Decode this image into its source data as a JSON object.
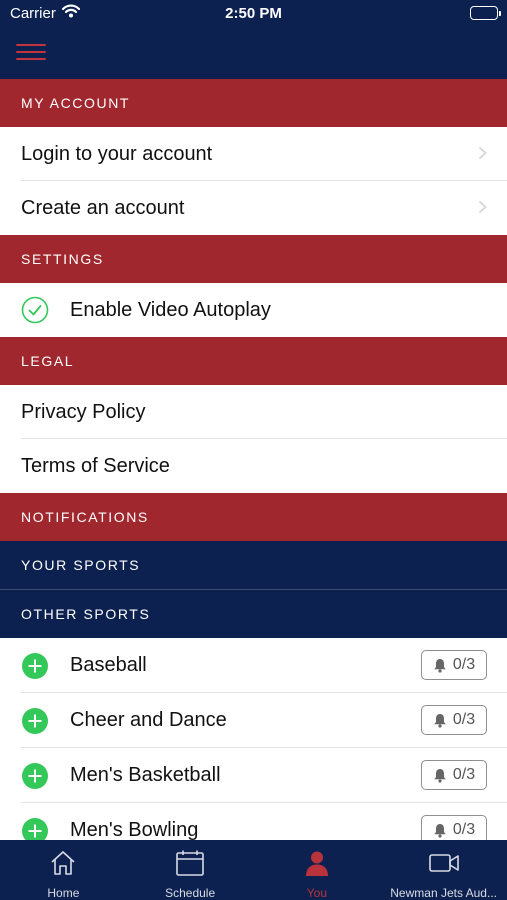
{
  "status_bar": {
    "carrier": "Carrier",
    "time": "2:50 PM"
  },
  "colors": {
    "navy": "#0d2150",
    "red": "#a1272e",
    "green": "#34c759",
    "active_tab": "#b8333b"
  },
  "sections": {
    "my_account": {
      "title": "MY ACCOUNT",
      "items": [
        {
          "label": "Login to your account"
        },
        {
          "label": "Create an account"
        }
      ]
    },
    "settings": {
      "title": "SETTINGS",
      "items": [
        {
          "label": "Enable Video Autoplay",
          "checked": true
        }
      ]
    },
    "legal": {
      "title": "LEGAL",
      "items": [
        {
          "label": "Privacy Policy"
        },
        {
          "label": "Terms of Service"
        }
      ]
    },
    "notifications": {
      "title": "NOTIFICATIONS"
    },
    "your_sports": {
      "title": "YOUR SPORTS"
    },
    "other_sports": {
      "title": "OTHER SPORTS",
      "items": [
        {
          "label": "Baseball",
          "notifications": "0/3"
        },
        {
          "label": "Cheer and Dance",
          "notifications": "0/3"
        },
        {
          "label": "Men's Basketball",
          "notifications": "0/3"
        },
        {
          "label": "Men's Bowling",
          "notifications": "0/3"
        }
      ]
    }
  },
  "tab_bar": {
    "active": "You",
    "tabs": [
      {
        "label": "Home",
        "icon": "home-icon"
      },
      {
        "label": "Schedule",
        "icon": "calendar-icon"
      },
      {
        "label": "You",
        "icon": "person-icon"
      },
      {
        "label": "Newman Jets Aud...",
        "icon": "video-camera-icon"
      }
    ]
  }
}
